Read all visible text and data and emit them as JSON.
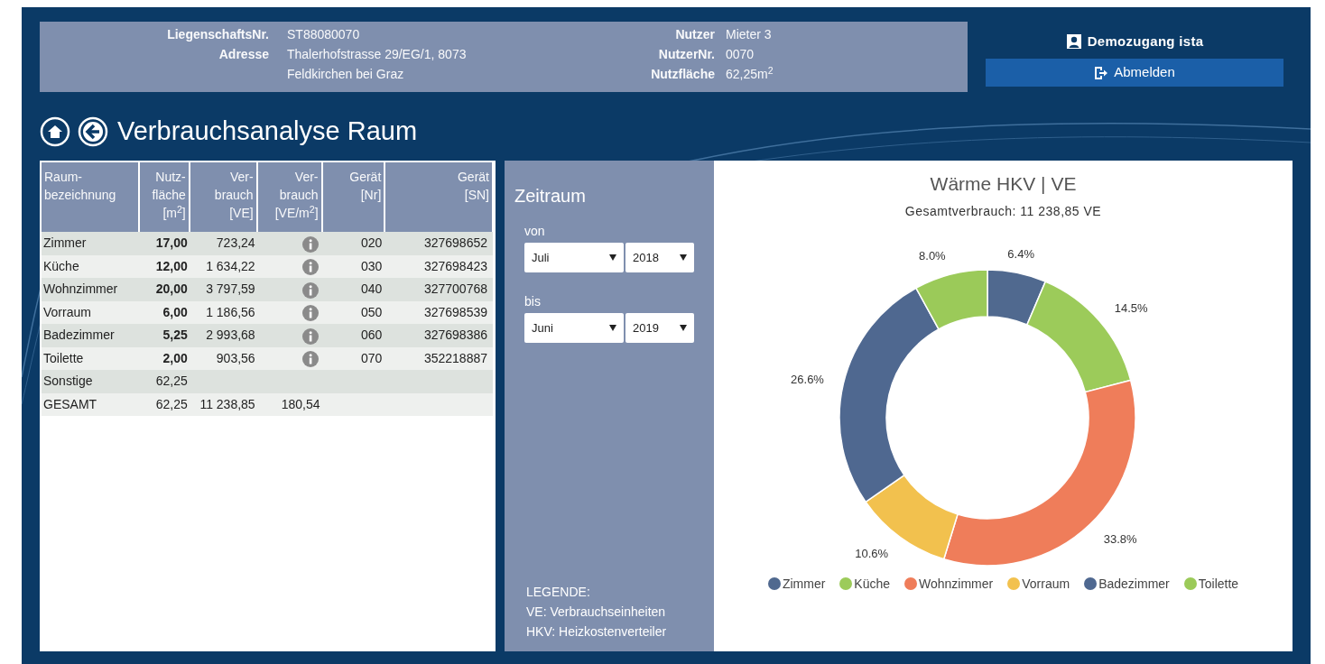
{
  "header": {
    "fields_left": [
      {
        "label": "LiegenschaftsNr.",
        "lines": [
          "ST88080070"
        ]
      },
      {
        "label": "Adresse",
        "lines": [
          "Thalerhofstrasse 29/EG/1, 8073",
          "Feldkirchen bei Graz"
        ]
      }
    ],
    "fields_right": [
      {
        "label": "Nutzer",
        "lines": [
          "Mieter 3"
        ]
      },
      {
        "label": "NutzerNr.",
        "lines": [
          "0070"
        ]
      },
      {
        "label": "Nutzfläche",
        "lines": [
          "62,25m$^{2}$"
        ]
      }
    ],
    "account": "Demozugang ista",
    "logout_button": "Abmelden"
  },
  "page_title": "Verbrauchsanalyse Raum",
  "table": {
    "columns": [
      {
        "lines": [
          "Raum-",
          "bezeichnung"
        ]
      },
      {
        "lines": [
          "Nutz-",
          "fläche",
          "[m$^{2}$]"
        ]
      },
      {
        "lines": [
          "Ver-",
          "brauch",
          "[VE]"
        ]
      },
      {
        "lines": [
          "Ver-",
          "brauch",
          "[VE/m$^{2}$]"
        ]
      },
      {
        "lines": [
          "Gerät",
          "[Nr]"
        ]
      },
      {
        "lines": [
          "Gerät",
          "[SN]"
        ]
      }
    ],
    "rows": [
      {
        "kind": "room",
        "name": "Zimmer",
        "area": "17,00",
        "consumption": "723,24",
        "info_icon": true,
        "device_nr": "020",
        "device_sn": "327698652"
      },
      {
        "kind": "room",
        "name": "Küche",
        "area": "12,00",
        "consumption": "1 634,22",
        "info_icon": true,
        "device_nr": "030",
        "device_sn": "327698423"
      },
      {
        "kind": "room",
        "name": "Wohnzimmer",
        "area": "20,00",
        "consumption": "3 797,59",
        "info_icon": true,
        "device_nr": "040",
        "device_sn": "327700768"
      },
      {
        "kind": "room",
        "name": "Vorraum",
        "area": "6,00",
        "consumption": "1 186,56",
        "info_icon": true,
        "device_nr": "050",
        "device_sn": "327698539"
      },
      {
        "kind": "room",
        "name": "Badezimmer",
        "area": "5,25",
        "consumption": "2 993,68",
        "info_icon": true,
        "device_nr": "060",
        "device_sn": "327698386"
      },
      {
        "kind": "room",
        "name": "Toilette",
        "area": "2,00",
        "consumption": "903,56",
        "info_icon": true,
        "device_nr": "070",
        "device_sn": "352218887"
      },
      {
        "kind": "summary",
        "name": "Sonstige",
        "area": "62,25"
      },
      {
        "kind": "summary",
        "name": "GESAMT",
        "area": "62,25",
        "consumption": "11 238,85",
        "per_area": "180,54"
      }
    ]
  },
  "period": {
    "title": "Zeitraum",
    "ranges": [
      {
        "label": "von",
        "month": "Juli",
        "year": "2018"
      },
      {
        "label": "bis",
        "month": "Juni",
        "year": "2019"
      }
    ],
    "legend_lines": [
      "LEGENDE:",
      "VE: Verbrauchseinheiten",
      "HKV: Heizkostenverteiler"
    ]
  },
  "chart": {
    "title": "Wärme HKV | VE",
    "subtitle": "Gesamtverbrauch: 11 238,85 VE",
    "chart_data": {
      "type": "donut",
      "categories": [
        "Zimmer",
        "Küche",
        "Wohnzimmer",
        "Vorraum",
        "Badezimmer",
        "Toilette"
      ],
      "values": [
        6.4,
        14.5,
        33.8,
        10.6,
        26.6,
        8.0
      ],
      "value_labels": [
        "6.4%",
        "14.5%",
        "33.8%",
        "10.6%",
        "26.6%",
        "8.0%"
      ]
    },
    "legend": [
      {
        "color": "#50698f"
      },
      {
        "color": "#9ccb5a"
      },
      {
        "color": "#ef7d5a"
      },
      {
        "color": "#f2c14e"
      },
      {
        "color": "#4f6890"
      },
      {
        "color": "#9bca59"
      }
    ]
  }
}
